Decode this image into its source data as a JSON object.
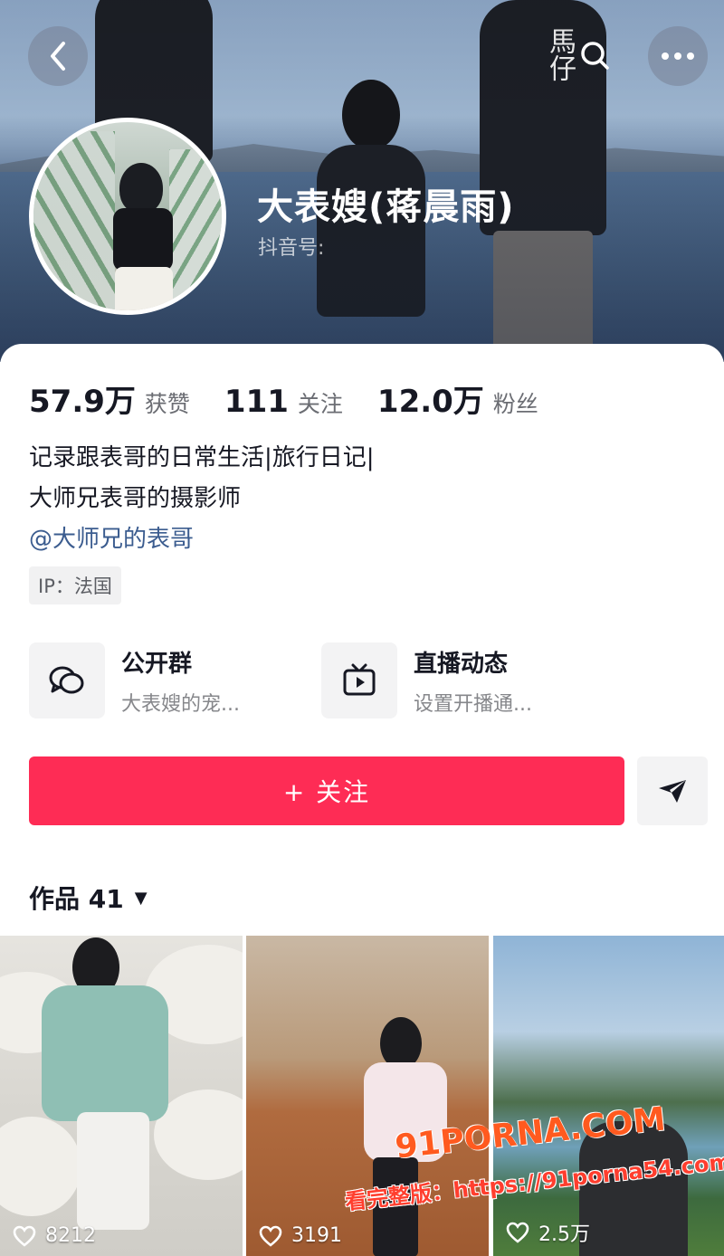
{
  "header": {
    "name": "大表嫂(蒋晨雨)",
    "douyin_id_label": "抖音号:",
    "shirt_text": "馬仔"
  },
  "stats": [
    {
      "value": "57.9万",
      "label": "获赞"
    },
    {
      "value": "111",
      "label": "关注"
    },
    {
      "value": "12.0万",
      "label": "粉丝"
    }
  ],
  "bio": {
    "line1": "记录跟表哥的日常生活|旅行日记|",
    "line2": "大师兄表哥的摄影师",
    "mention": "@大师兄的表哥"
  },
  "ip_tag": "IP：法国",
  "features": {
    "group": {
      "title": "公开群",
      "subtitle": "大表嫂的宠..."
    },
    "live": {
      "title": "直播动态",
      "subtitle": "设置开播通..."
    }
  },
  "actions": {
    "follow_label": "+ 关注"
  },
  "works": {
    "tab_label": "作品 41"
  },
  "videos": [
    {
      "likes": "8212"
    },
    {
      "likes": "3191"
    },
    {
      "likes": "2.5万"
    }
  ],
  "watermark": {
    "line1": "91PORNA.COM",
    "line2": "看完整版：https://91porna54.com"
  },
  "colors": {
    "accent": "#fe2c55",
    "mention": "#3b5c8f"
  }
}
